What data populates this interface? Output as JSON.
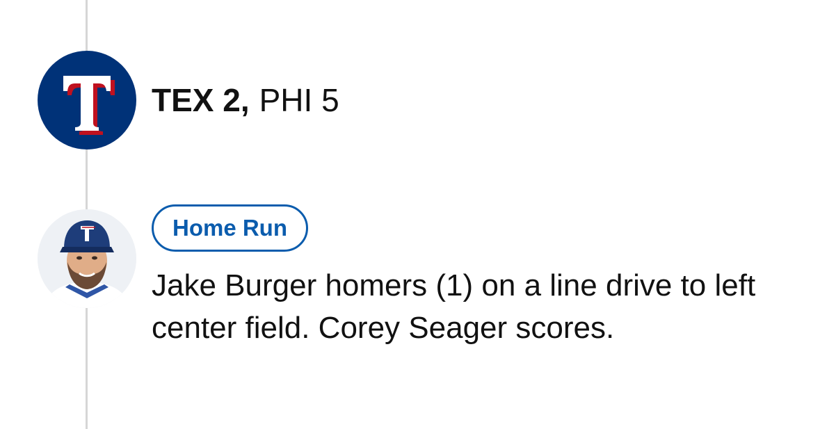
{
  "timeline": {
    "score_update": {
      "team_logo_icon": "rangers-t-logo-icon",
      "away_team": "TEX 2",
      "separator": ",",
      "home_team": "PHI 5"
    },
    "play": {
      "avatar": "player-headshot",
      "badge_label": "Home Run",
      "description": "Jake Burger homers (1) on a line drive to left center field. Corey Seager scores."
    }
  },
  "colors": {
    "rangers_blue": "#003278",
    "rangers_red": "#C0111F",
    "badge_blue": "#0B5CAD",
    "timeline_gray": "#D6D6D6"
  }
}
